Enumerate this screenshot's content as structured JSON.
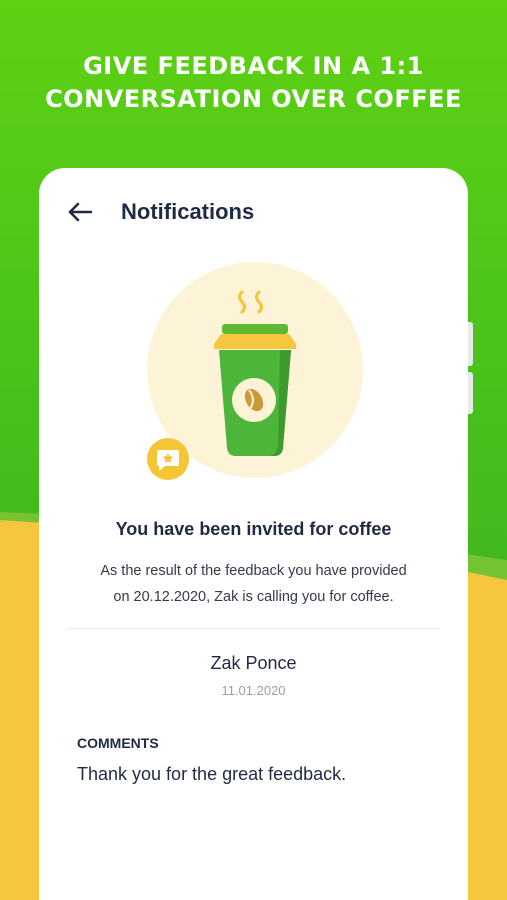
{
  "promo": {
    "headline_line1": "GIVE FEEDBACK IN A 1:1",
    "headline_line2": "CONVERSATION OVER COFFEE"
  },
  "header": {
    "back_icon": "arrow-left-icon",
    "title": "Notifications"
  },
  "illustration": {
    "cup_icon": "coffee-cup-icon",
    "badge_icon": "feedback-star-icon"
  },
  "notification": {
    "title": "You have been invited for coffee",
    "desc_line1": "As the result of the feedback you have provided",
    "desc_line2": "on 20.12.2020, Zak is calling you for coffee."
  },
  "sender": {
    "name": "Zak Ponce",
    "date": "11.01.2020"
  },
  "comments": {
    "label": "COMMENTS",
    "text": "Thank you for the great feedback."
  },
  "colors": {
    "brand_green": "#3fb51f",
    "accent_yellow": "#f6c73e",
    "text_dark": "#1f2a44",
    "muted": "#9aa0ab"
  }
}
